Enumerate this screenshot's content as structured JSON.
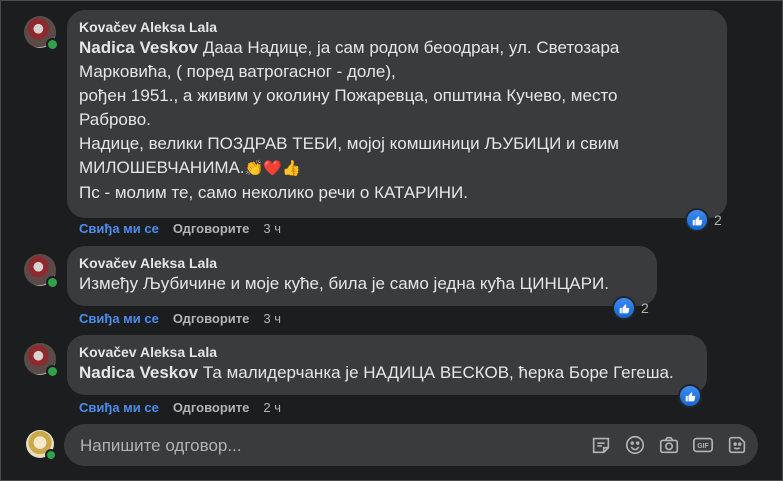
{
  "comments": [
    {
      "author": "Kovačev Aleksa Lala",
      "mention": "Nadica Veskov",
      "body_lead": "Дааа Надице, ја сам родом беоодран, ул. Светозара",
      "body_rest": "Марковића, ( поред ватрогасног - доле),\nрођен 1951., а живим у околину Пожаревца, општина Кучево, место\nРаброво.\nНадице, велики ПОЗДРАВ ТЕБИ, мојој комшиници ЉУБИЦИ и свим\nМИЛОШЕВЧАНИМА.",
      "body_tail": "Пс - молим те, само неколико речи о КАТАРИНИ.",
      "like_label": "Свиђа ми се",
      "reply_label": "Одговорите",
      "time": "3 ч",
      "reaction_count": "2"
    },
    {
      "author": "Kovačev Aleksa Lala",
      "body": "Између Љубичине и моје куће, била је само једна кућа ЦИНЦАРИ.",
      "like_label": "Свиђа ми се",
      "reply_label": "Одговорите",
      "time": "3 ч",
      "reaction_count": "2"
    },
    {
      "author": "Kovačev Aleksa Lala",
      "mention": "Nadica Veskov",
      "body": "Та малидерчанка је НАДИЦА ВЕСКОВ, ћерка Боре Гегеша.",
      "like_label": "Свиђа ми се",
      "reply_label": "Одговорите",
      "time": "2 ч"
    }
  ],
  "composer": {
    "placeholder": "Напишите одговор...",
    "tools": [
      "sticker-icon",
      "emoji-icon",
      "camera-icon",
      "gif-icon",
      "avatar-sticker-icon"
    ]
  },
  "colors": {
    "background": "#1c1d1f",
    "bubble": "#3a3b3c",
    "accent": "#4c8cf0",
    "online": "#31a24c"
  }
}
